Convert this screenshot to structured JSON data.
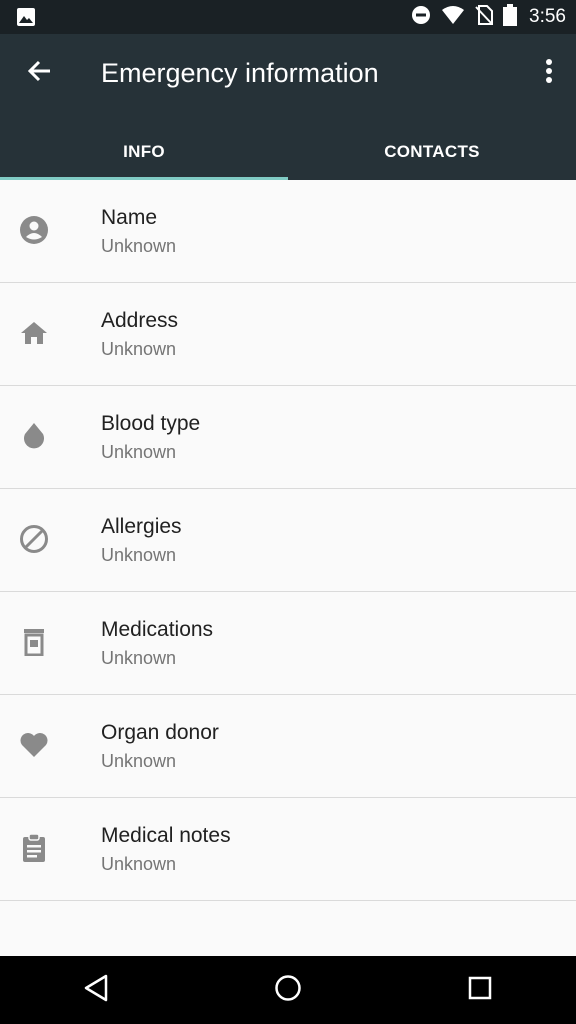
{
  "status_bar": {
    "time": "3:56",
    "icons": [
      "image-icon",
      "do-not-disturb-icon",
      "wifi-icon",
      "no-sim-icon",
      "battery-icon"
    ]
  },
  "app_bar": {
    "title": "Emergency information",
    "back_icon": "arrow-back-icon",
    "menu_icon": "more-vert-icon"
  },
  "tabs": [
    {
      "label": "INFO",
      "active": true
    },
    {
      "label": "CONTACTS",
      "active": false
    }
  ],
  "items": [
    {
      "icon": "person-icon",
      "label": "Name",
      "value": "Unknown"
    },
    {
      "icon": "home-icon",
      "label": "Address",
      "value": "Unknown"
    },
    {
      "icon": "drop-icon",
      "label": "Blood type",
      "value": "Unknown"
    },
    {
      "icon": "block-icon",
      "label": "Allergies",
      "value": "Unknown"
    },
    {
      "icon": "medication-icon",
      "label": "Medications",
      "value": "Unknown"
    },
    {
      "icon": "heart-icon",
      "label": "Organ donor",
      "value": "Unknown"
    },
    {
      "icon": "clipboard-icon",
      "label": "Medical notes",
      "value": "Unknown"
    }
  ],
  "nav_bar": [
    "back-icon",
    "home-icon",
    "recents-icon"
  ],
  "colors": {
    "status_bar": "#1a2125",
    "app_bar": "#263238",
    "tab_indicator": "#80cbc4",
    "background": "#fafafa",
    "icon": "#8a8a8a"
  }
}
